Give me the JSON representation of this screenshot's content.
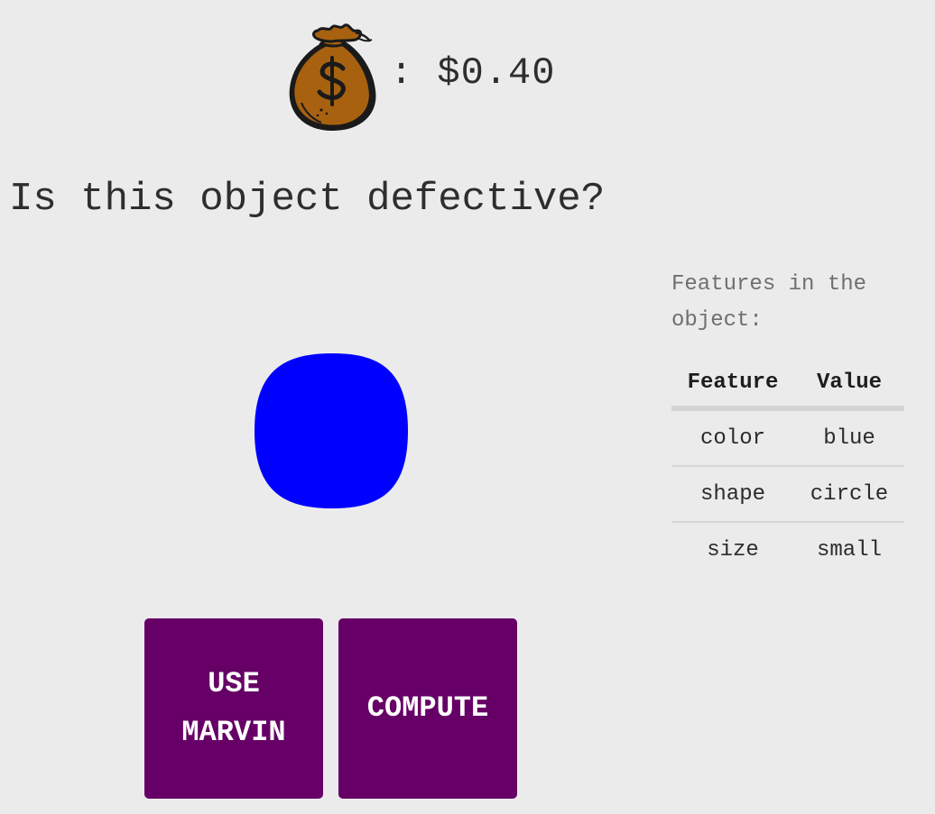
{
  "header": {
    "icon": "money-bag-icon",
    "balance_text": ": $0.40"
  },
  "question": {
    "text": "Is this object defective?"
  },
  "object": {
    "color": "#0000ff",
    "shape": "circle",
    "size": "small"
  },
  "features": {
    "caption": "Features in the object:",
    "columns": [
      "Feature",
      "Value"
    ],
    "rows": [
      {
        "feature": "color",
        "value": "blue"
      },
      {
        "feature": "shape",
        "value": "circle"
      },
      {
        "feature": "size",
        "value": "small"
      }
    ]
  },
  "actions": {
    "marvin_label": "USE MARVIN",
    "compute_label": "COMPUTE",
    "button_color": "#660066"
  },
  "colors": {
    "background": "#ebebeb",
    "bag_fill": "#a8620f"
  }
}
